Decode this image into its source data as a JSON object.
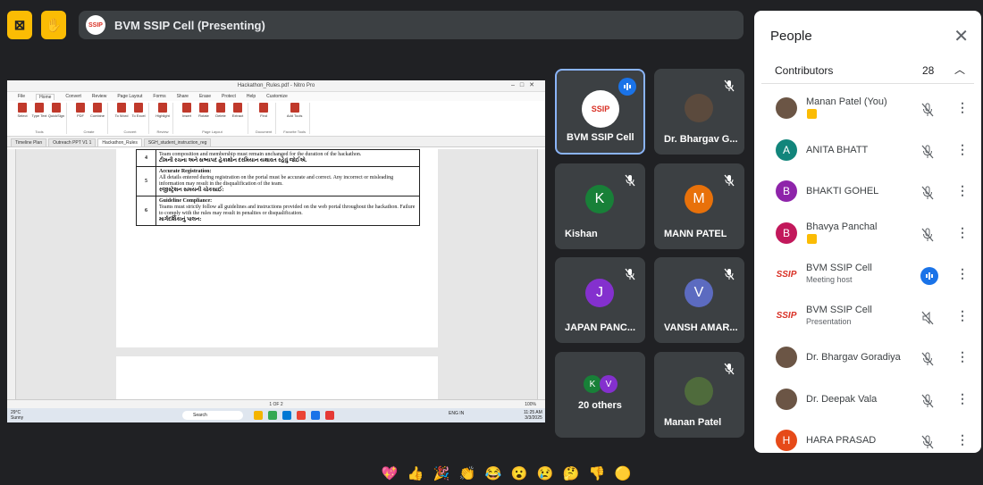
{
  "colors": {
    "bg": "#202124",
    "tile": "#3c4043",
    "accent_blue": "#1a73e8",
    "hand_yellow": "#fbbc04",
    "active_border": "#8ab4f8"
  },
  "top_bar": {
    "no_camera_icon": "camera-off-icon",
    "hand_icon": "raise-hand-icon",
    "presenting_label": "BVM SSIP Cell (Presenting)",
    "logo_text": "SSIP"
  },
  "shared_screen": {
    "window_title": "Hackathon_Rules.pdf - Nitro Pro",
    "ribbon_tabs": [
      "File",
      "Home",
      "Convert",
      "Review",
      "Page Layout",
      "Forms",
      "Share",
      "Erase",
      "Protect",
      "Help",
      "Customize"
    ],
    "ribbon_groups": [
      {
        "name": "Tools",
        "tools": [
          "Select",
          "Type Text",
          "QuickSign"
        ]
      },
      {
        "name": "Create",
        "tools": [
          "PDF",
          "Combine"
        ]
      },
      {
        "name": "Convert",
        "tools": [
          "To Word",
          "To Excel"
        ]
      },
      {
        "name": "Review",
        "tools": [
          "Highlight"
        ]
      },
      {
        "name": "Page Layout",
        "tools": [
          "Insert",
          "Rotate",
          "Delete",
          "Extract"
        ]
      },
      {
        "name": "Document",
        "tools": [
          "Find"
        ]
      },
      {
        "name": "Favorite Tools",
        "tools": [
          "Add Tools"
        ]
      }
    ],
    "doc_tabs": [
      "Timeline Plan",
      "Outreach PPT V1 1",
      "Hackathon_Rules",
      "SGH_student_instruction_reg"
    ],
    "rows": [
      {
        "num": "4",
        "text": "Team composition and membership must remain unchanged for the duration of the hackathon.",
        "gujarati": "ટીમની રચના અને સભ્યપદ હેકાથોન દરમિયાન યથાવત રહેવું જોઈએ."
      },
      {
        "num": "5",
        "heading": "Accurate Registration:",
        "text": "All details entered during registration on the portal must be accurate and correct. Any incorrect or misleading information may result in the disqualification of the team.",
        "gujarati": "રજીસ્ટ્રેશન સમયની ચોકસાઈ:"
      },
      {
        "num": "6",
        "heading": "Guideline Compliance:",
        "text": "Teams must strictly follow all guidelines and instructions provided on the web portal throughout the hackathon. Failure to comply with the rules may result in penalties or disqualification.",
        "gujarati": "માર્ગદર્શિકાનું પાલન:"
      }
    ],
    "page_status": "1 OF 2",
    "zoom": "100%",
    "taskbar": {
      "weather": "29°C",
      "weather_desc": "Sunny",
      "search_placeholder": "Search",
      "tray_lang": "ENG IN",
      "time": "11:25 AM",
      "date": "3/3/2025"
    }
  },
  "tiles": [
    {
      "name": "BVM SSIP Cell",
      "kind": "logo",
      "logo_text": "SSIP",
      "speaking": true
    },
    {
      "name": "Dr. Bhargav G...",
      "kind": "photo",
      "muted": true
    },
    {
      "name": "Kishan",
      "kind": "initial",
      "initial": "K",
      "color": "#188038",
      "muted": true
    },
    {
      "name": "MANN PATEL",
      "kind": "initial",
      "initial": "M",
      "color": "#e8710a",
      "muted": true
    },
    {
      "name": "JAPAN PANC...",
      "kind": "initial",
      "initial": "J",
      "color": "#8430ce",
      "muted": true
    },
    {
      "name": "VANSH AMAR...",
      "kind": "initial",
      "initial": "V",
      "color": "#5c6bc0",
      "muted": true
    },
    {
      "name": "20 others",
      "kind": "group",
      "initials": [
        "K",
        "V"
      ],
      "colors": [
        "#188038",
        "#8430ce"
      ]
    },
    {
      "name": "Manan Patel",
      "kind": "photo",
      "muted": true
    }
  ],
  "panel": {
    "title": "People",
    "section_label": "Contributors",
    "section_count": "28",
    "people": [
      {
        "name": "Manan Patel (You)",
        "avatar": "photo",
        "hand": true,
        "mic": "off"
      },
      {
        "name": "ANITA BHATT",
        "initial": "A",
        "color": "#12857b",
        "mic": "off"
      },
      {
        "name": "BHAKTI GOHEL",
        "initial": "B",
        "color": "#8e24aa",
        "mic": "off"
      },
      {
        "name": "Bhavya Panchal",
        "initial": "B",
        "color": "#c2185b",
        "hand": true,
        "mic": "off"
      },
      {
        "name": "BVM SSIP Cell",
        "sub": "Meeting host",
        "avatar": "ssip",
        "logo_text": "SSIP",
        "mic": "on"
      },
      {
        "name": "BVM SSIP Cell",
        "sub": "Presentation",
        "avatar": "ssip",
        "logo_text": "SSIP",
        "mic": "present-off"
      },
      {
        "name": "Dr. Bhargav Goradiya",
        "avatar": "photo",
        "mic": "off"
      },
      {
        "name": "Dr. Deepak Vala",
        "avatar": "photo",
        "mic": "off"
      },
      {
        "name": "HARA PRASAD",
        "initial": "H",
        "color": "#e64a19",
        "mic": "off"
      }
    ]
  },
  "reactions": [
    "💖",
    "👍",
    "🎉",
    "👏",
    "😂",
    "😮",
    "😢",
    "🤔",
    "👎",
    "🟡"
  ]
}
